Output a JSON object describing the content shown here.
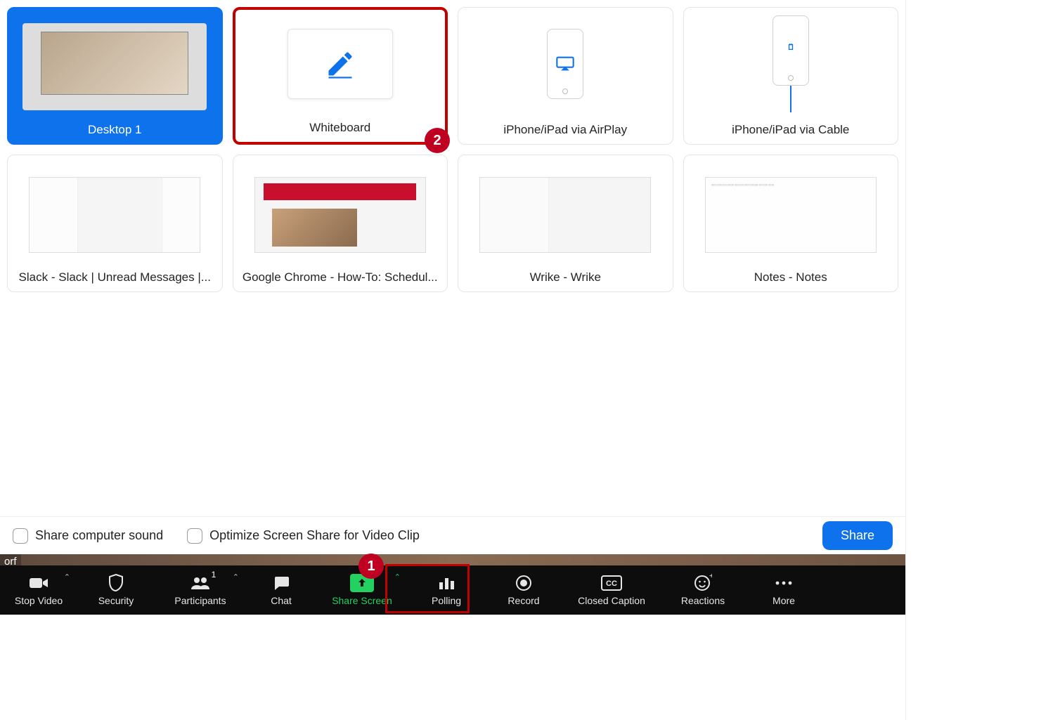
{
  "tiles": [
    {
      "label": "Desktop 1"
    },
    {
      "label": "Whiteboard"
    },
    {
      "label": "iPhone/iPad via AirPlay"
    },
    {
      "label": "iPhone/iPad via Cable"
    },
    {
      "label": "Slack - Slack | Unread Messages |..."
    },
    {
      "label": "Google Chrome - How-To: Schedul..."
    },
    {
      "label": "Wrike - Wrike"
    },
    {
      "label": "Notes - Notes"
    }
  ],
  "options": {
    "share_sound": "Share computer sound",
    "optimize_clip": "Optimize Screen Share for Video Clip"
  },
  "share_button": "Share",
  "participant_name_fragment": "orf",
  "callouts": {
    "one": "1",
    "two": "2"
  },
  "toolbar": {
    "stop_video": "Stop Video",
    "security": "Security",
    "participants": "Participants",
    "participants_count": "1",
    "chat": "Chat",
    "share_screen": "Share Screen",
    "polling": "Polling",
    "record": "Record",
    "closed_caption": "Closed Caption",
    "reactions": "Reactions",
    "more": "More"
  },
  "colors": {
    "zoom_blue": "#0e72ed",
    "highlight_red": "#c20000",
    "toolbar_green": "#23d160"
  }
}
